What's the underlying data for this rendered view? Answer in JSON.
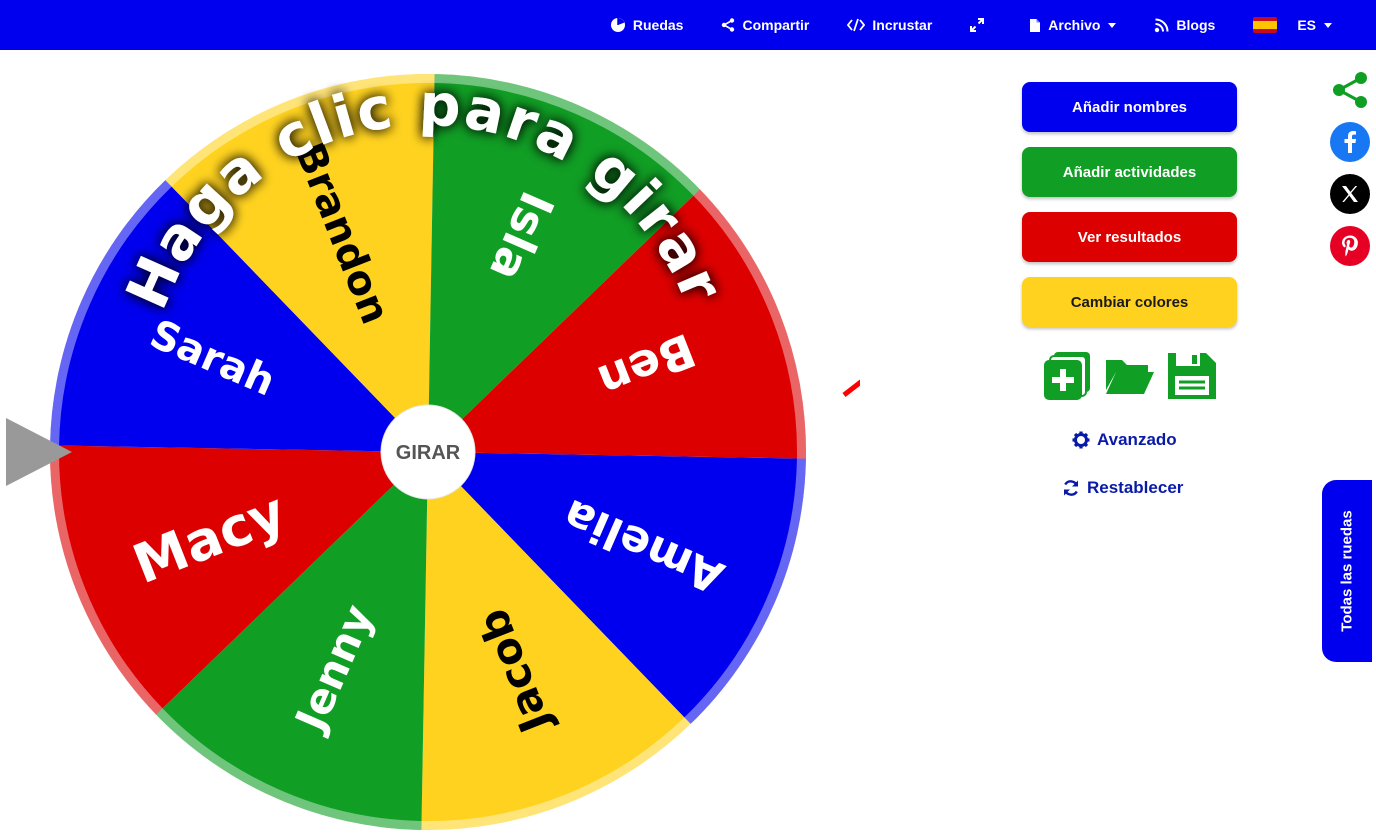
{
  "nav": {
    "wheels": "Ruedas",
    "share": "Compartir",
    "embed": "Incrustar",
    "file": "Archivo",
    "blogs": "Blogs",
    "lang": "ES"
  },
  "wheel": {
    "spin_label": "GIRAR",
    "overlay_text": "Haga clic para girar",
    "segments": [
      {
        "label": "Amelia",
        "color": "#0000ee",
        "text_color": "#ffffff",
        "font_size": 44
      },
      {
        "label": "Jacob",
        "color": "#ffd21f",
        "text_color": "#000000",
        "font_size": 42
      },
      {
        "label": "Jenny",
        "color": "#109e24",
        "text_color": "#ffffff",
        "font_size": 42
      },
      {
        "label": "Macy",
        "color": "#dd0000",
        "text_color": "#ffffff",
        "font_size": 54
      },
      {
        "label": "Sarah",
        "color": "#0000ee",
        "text_color": "#ffffff",
        "font_size": 40
      },
      {
        "label": "Brandon",
        "color": "#ffd21f",
        "text_color": "#000000",
        "font_size": 40
      },
      {
        "label": "Isla",
        "color": "#109e24",
        "text_color": "#ffffff",
        "font_size": 46
      },
      {
        "label": "Ben",
        "color": "#dd0000",
        "text_color": "#ffffff",
        "font_size": 46
      }
    ],
    "pointer_color": "#999999"
  },
  "panel": {
    "add_names": "Añadir nombres",
    "add_activities": "Añadir actividades",
    "view_results": "Ver resultados",
    "change_colors": "Cambiar colores",
    "advanced": "Avanzado",
    "reset": "Restablecer",
    "icons": [
      "new-file-icon",
      "open-folder-icon",
      "save-icon"
    ]
  },
  "sidebar": {
    "all_wheels": "Todas las ruedas",
    "social_icons": [
      "share-icon",
      "facebook-icon",
      "x-icon",
      "pinterest-icon"
    ]
  },
  "annotation": {
    "arrow_color": "#ff0000"
  }
}
